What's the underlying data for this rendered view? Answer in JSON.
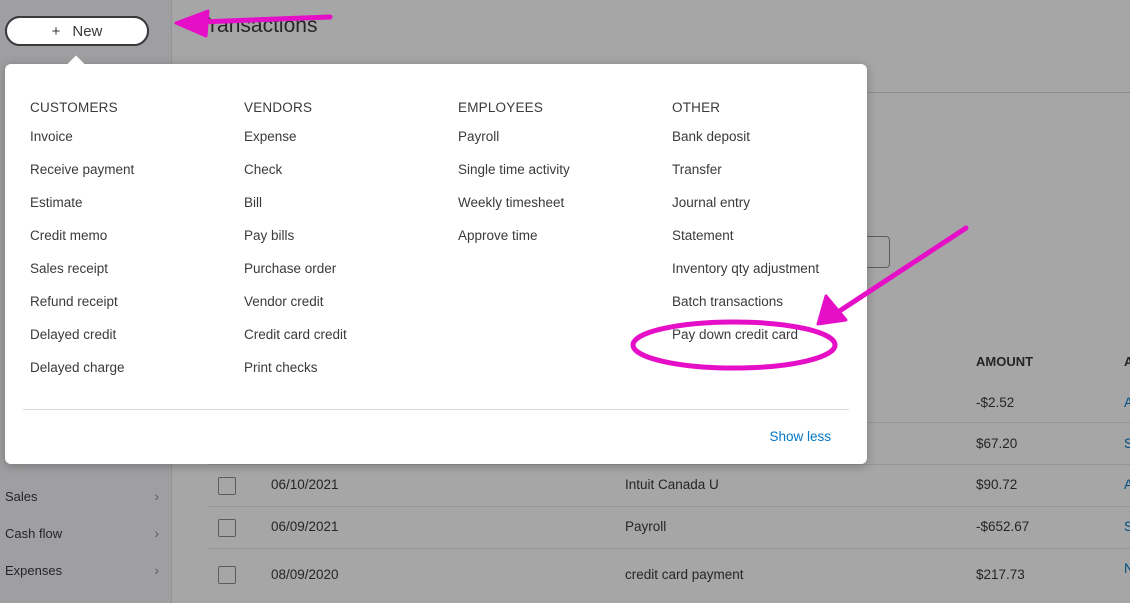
{
  "sidebar": {
    "new_button": {
      "icon": "+",
      "label": "New"
    },
    "items": [
      {
        "label": "Sales"
      },
      {
        "label": "Cash flow"
      },
      {
        "label": "Expenses"
      }
    ]
  },
  "main": {
    "title": "Transactions",
    "table": {
      "headers": {
        "amount": "AMOUNT",
        "action_partial": "A"
      },
      "rows": [
        {
          "date": "",
          "description": "",
          "amount": "-$2.52",
          "action": "A"
        },
        {
          "date": "",
          "description": "",
          "amount": "$67.20",
          "action": "S"
        },
        {
          "date": "06/10/2021",
          "description": "Intuit Canada U",
          "amount": "$90.72",
          "action": "A"
        },
        {
          "date": "06/09/2021",
          "description": "Payroll",
          "amount": "-$652.67",
          "action": "S"
        },
        {
          "date": "08/09/2020",
          "description": "credit card payment",
          "amount": "$217.73",
          "action": "N"
        }
      ]
    }
  },
  "new_menu": {
    "columns": [
      {
        "title": "CUSTOMERS",
        "items": [
          "Invoice",
          "Receive payment",
          "Estimate",
          "Credit memo",
          "Sales receipt",
          "Refund receipt",
          "Delayed credit",
          "Delayed charge"
        ]
      },
      {
        "title": "VENDORS",
        "items": [
          "Expense",
          "Check",
          "Bill",
          "Pay bills",
          "Purchase order",
          "Vendor credit",
          "Credit card credit",
          "Print checks"
        ]
      },
      {
        "title": "EMPLOYEES",
        "items": [
          "Payroll",
          "Single time activity",
          "Weekly timesheet",
          "Approve time"
        ]
      },
      {
        "title": "OTHER",
        "items": [
          "Bank deposit",
          "Transfer",
          "Journal entry",
          "Statement",
          "Inventory qty adjustment",
          "Batch transactions",
          "Pay down credit card"
        ]
      }
    ],
    "show_less": "Show less"
  },
  "annotation_color": "#e60fc8",
  "colors": {
    "link": "#0077c5",
    "text": "#393a3d"
  }
}
